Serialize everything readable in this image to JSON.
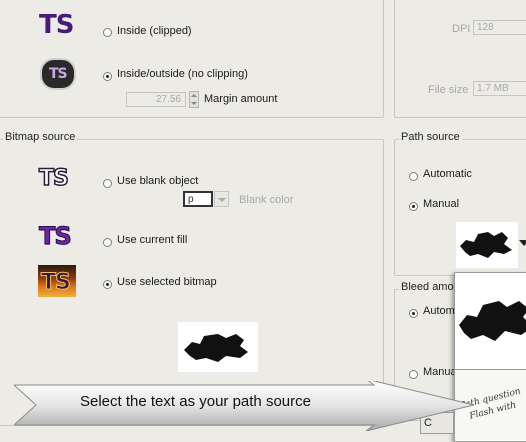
{
  "clipping": {
    "inside_clipped": "Inside (clipped)",
    "inside_outside": "Inside/outside (no clipping)",
    "margin_value": "27.56",
    "margin_label": "Margin amount"
  },
  "resolution": {
    "dpi_label": "DPI",
    "dpi_value": "128",
    "filesize_label": "File size",
    "filesize_value": "1.7 MB"
  },
  "bitmap_source": {
    "title": "Bitmap source",
    "blank_object": "Use blank object",
    "blank_color_value": "p",
    "blank_color_label": "Blank color",
    "current_fill": "Use current fill",
    "selected_bitmap": "Use selected bitmap"
  },
  "path_source": {
    "title": "Path source",
    "automatic": "Automatic",
    "manual": "Manual"
  },
  "bleed": {
    "title": "Bleed amou",
    "automatic": "Automa",
    "manual": "Manual"
  },
  "callout": {
    "text": "Select the text as your path source"
  },
  "popup": {
    "handwriting_line1": "Path question",
    "handwriting_line2": "Flash with"
  },
  "bottom_button": {
    "label": "C"
  },
  "logos": {
    "ts": "TS"
  },
  "colors": {
    "ts_purple": "#4a1a7a",
    "ts_outline": "#2a1a3a",
    "accent_fire": "#d06010"
  }
}
